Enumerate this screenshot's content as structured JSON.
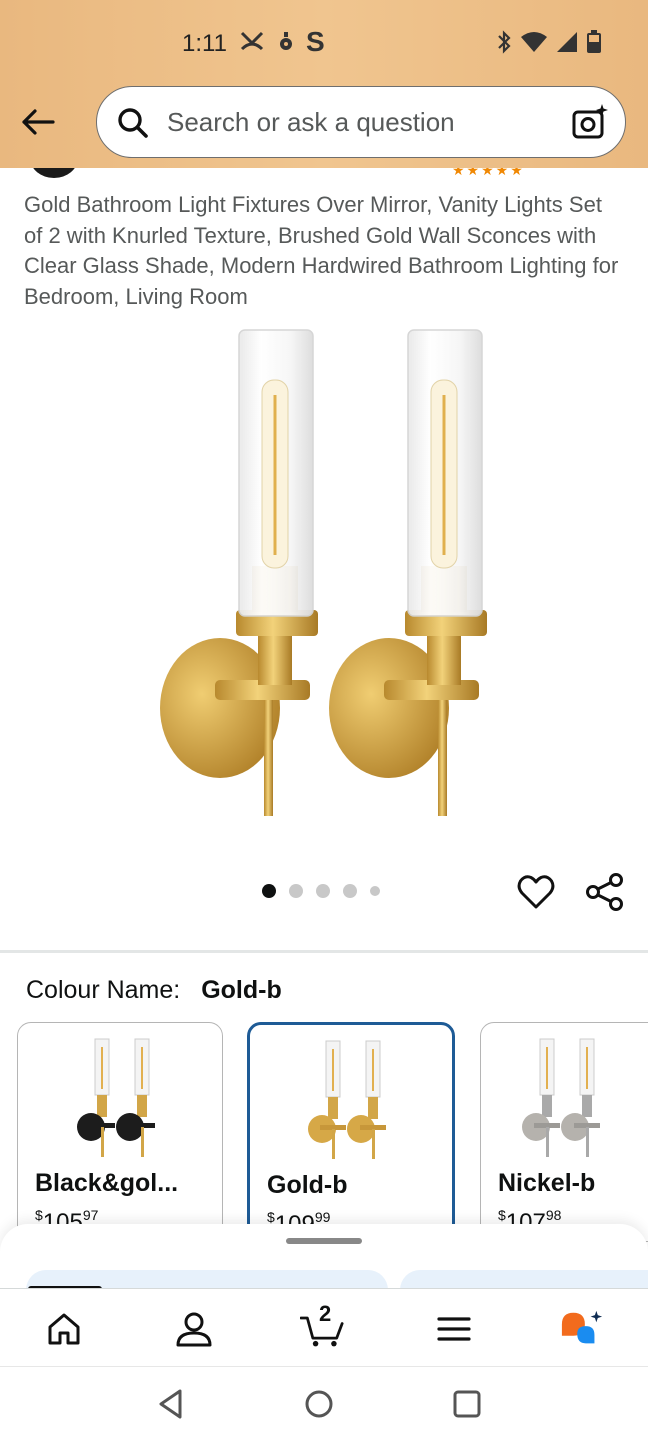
{
  "status_bar": {
    "time": "1:11",
    "left_icons": [
      "call-forward-icon",
      "location-icon",
      "app-s-icon"
    ],
    "right_icons": [
      "bluetooth-icon",
      "wifi-icon",
      "signal-icon",
      "battery-icon"
    ],
    "s_glyph": "S"
  },
  "header": {
    "search_placeholder": "Search or ask a question",
    "colors": {
      "bar": "#EEC08A"
    }
  },
  "product": {
    "title": "Gold Bathroom Light Fixtures Over Mirror, Vanity Lights Set of 2 with Knurled Texture, Brushed Gold Wall Sconces with Clear Glass Shade, Modern Hardwired Bathroom Lighting for Bedroom, Living Room",
    "image_count": 5,
    "active_image": 1
  },
  "variants": {
    "label": "Colour Name:",
    "selected": "Gold-b",
    "options": [
      {
        "name": "Black&gol...",
        "currency": "$",
        "price_whole": "105",
        "price_fraction": "97",
        "finish": "black"
      },
      {
        "name": "Gold-b",
        "currency": "$",
        "price_whole": "109",
        "price_fraction": "99",
        "finish": "gold"
      },
      {
        "name": "Nickel-b",
        "currency": "$",
        "price_whole": "107",
        "price_fraction": "98",
        "finish": "nickel"
      }
    ]
  },
  "bottom_nav": {
    "items": [
      "home-icon",
      "account-icon",
      "cart-icon",
      "menu-icon",
      "rufus-assistant-icon"
    ],
    "cart_count": "2"
  },
  "system_nav": [
    "back-icon",
    "home-circle-icon",
    "recents-icon"
  ]
}
